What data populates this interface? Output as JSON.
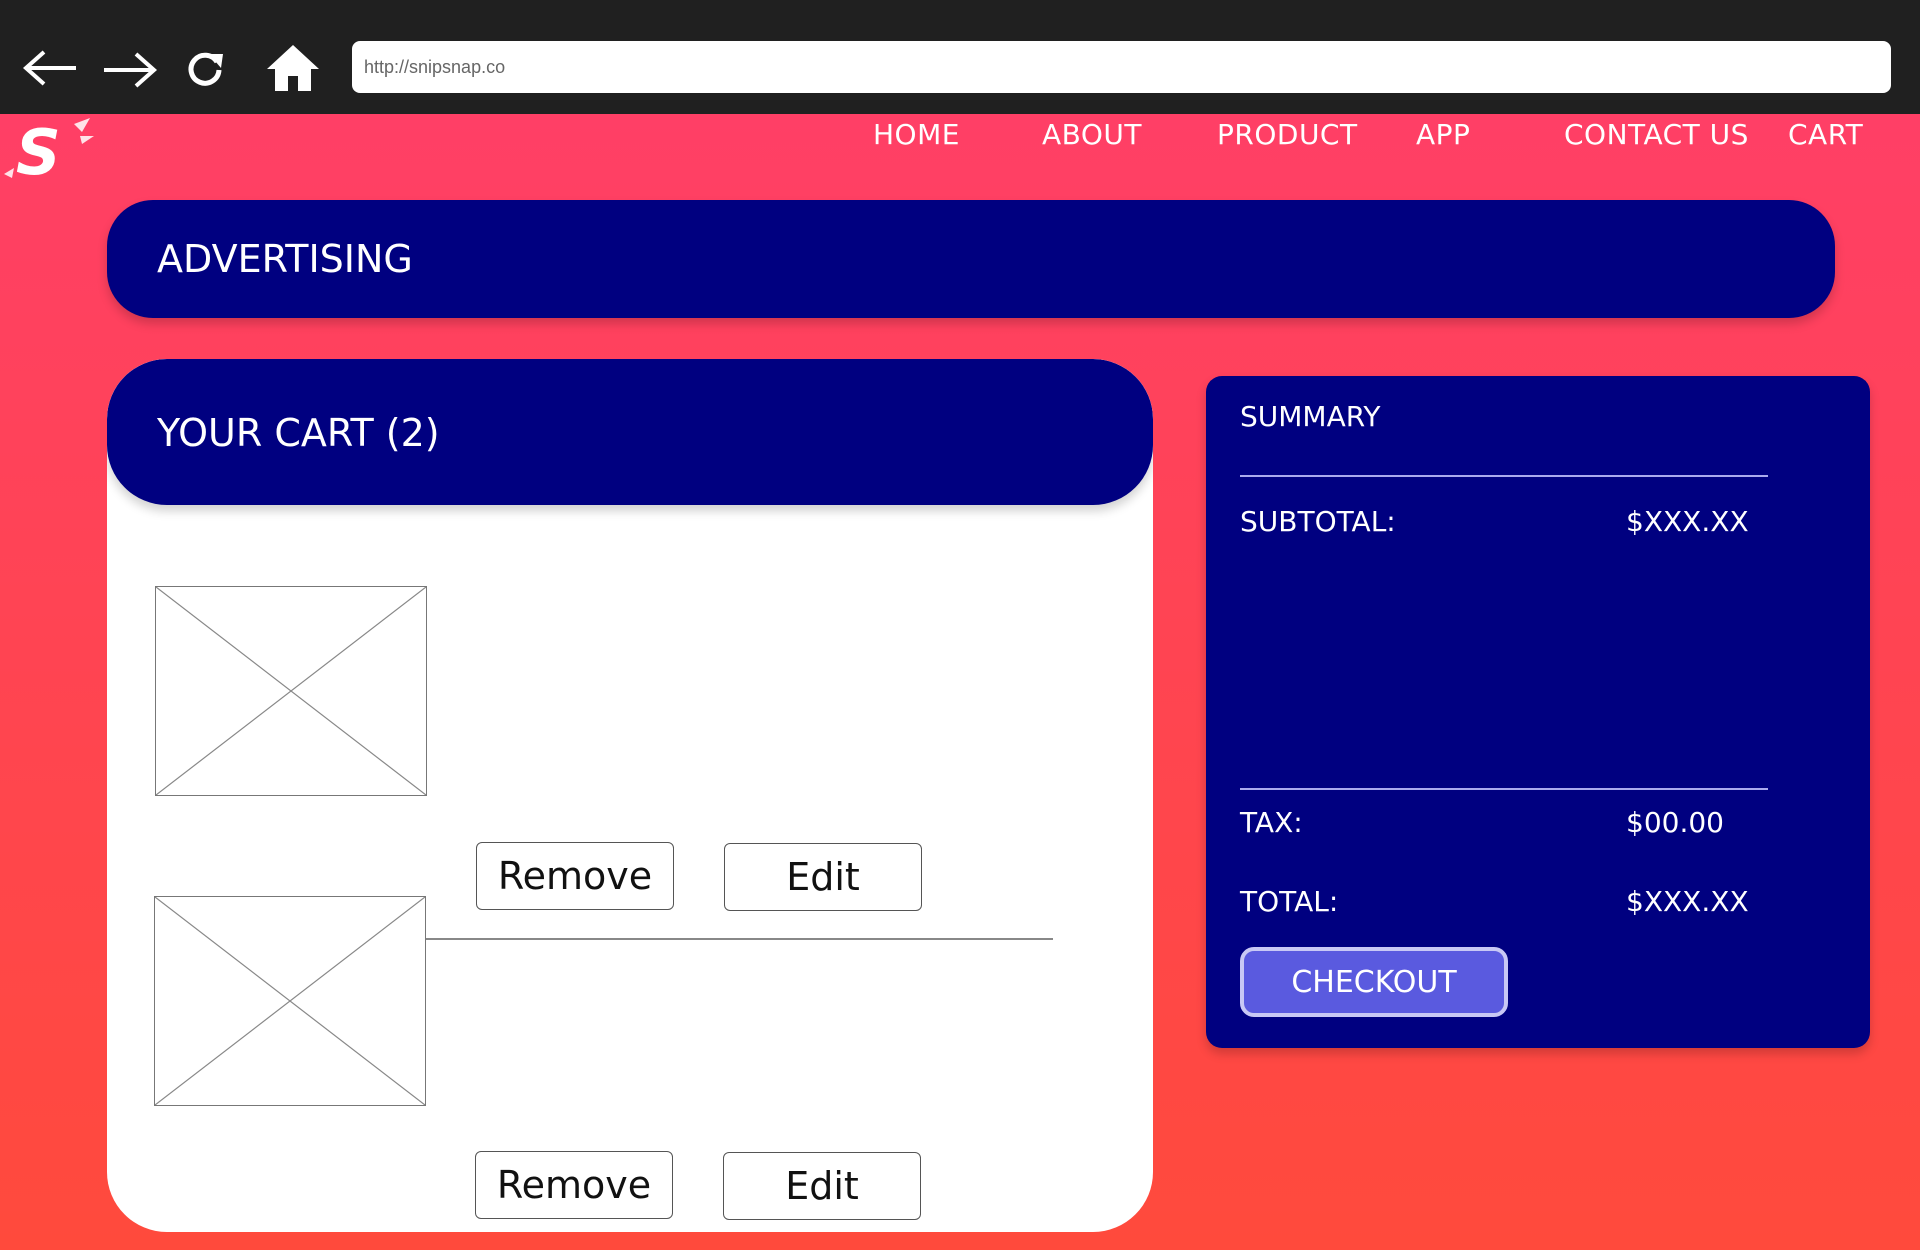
{
  "browser": {
    "url": "http://snipsnap.co",
    "back_icon": "arrow-left-icon",
    "forward_icon": "arrow-right-icon",
    "reload_icon": "reload-icon",
    "home_icon": "home-icon"
  },
  "brand": {
    "logo_letter": "S"
  },
  "nav": {
    "home": "HOME",
    "about": "ABOUT",
    "product": "PRODUCT",
    "app": "APP",
    "contact": "CONTACT US",
    "cart": "CART"
  },
  "advertising": {
    "label": "ADVERTISING"
  },
  "cart": {
    "title": "YOUR CART (2)",
    "items": [
      {
        "remove_label": "Remove",
        "edit_label": "Edit"
      },
      {
        "remove_label": "Remove",
        "edit_label": "Edit"
      }
    ]
  },
  "summary": {
    "title": "SUMMARY",
    "subtotal_label": "SUBTOTAL:",
    "subtotal_value": "$XXX.XX",
    "tax_label": "TAX:",
    "tax_value": "$00.00",
    "total_label": "TOTAL:",
    "total_value": "$XXX.XX",
    "checkout_label": "CHECKOUT"
  },
  "colors": {
    "chrome": "#202020",
    "page_gradient_top": "#ff3f66",
    "page_gradient_bottom": "#ff4a3c",
    "panel": "#000080",
    "checkout": "#5a5adf"
  }
}
